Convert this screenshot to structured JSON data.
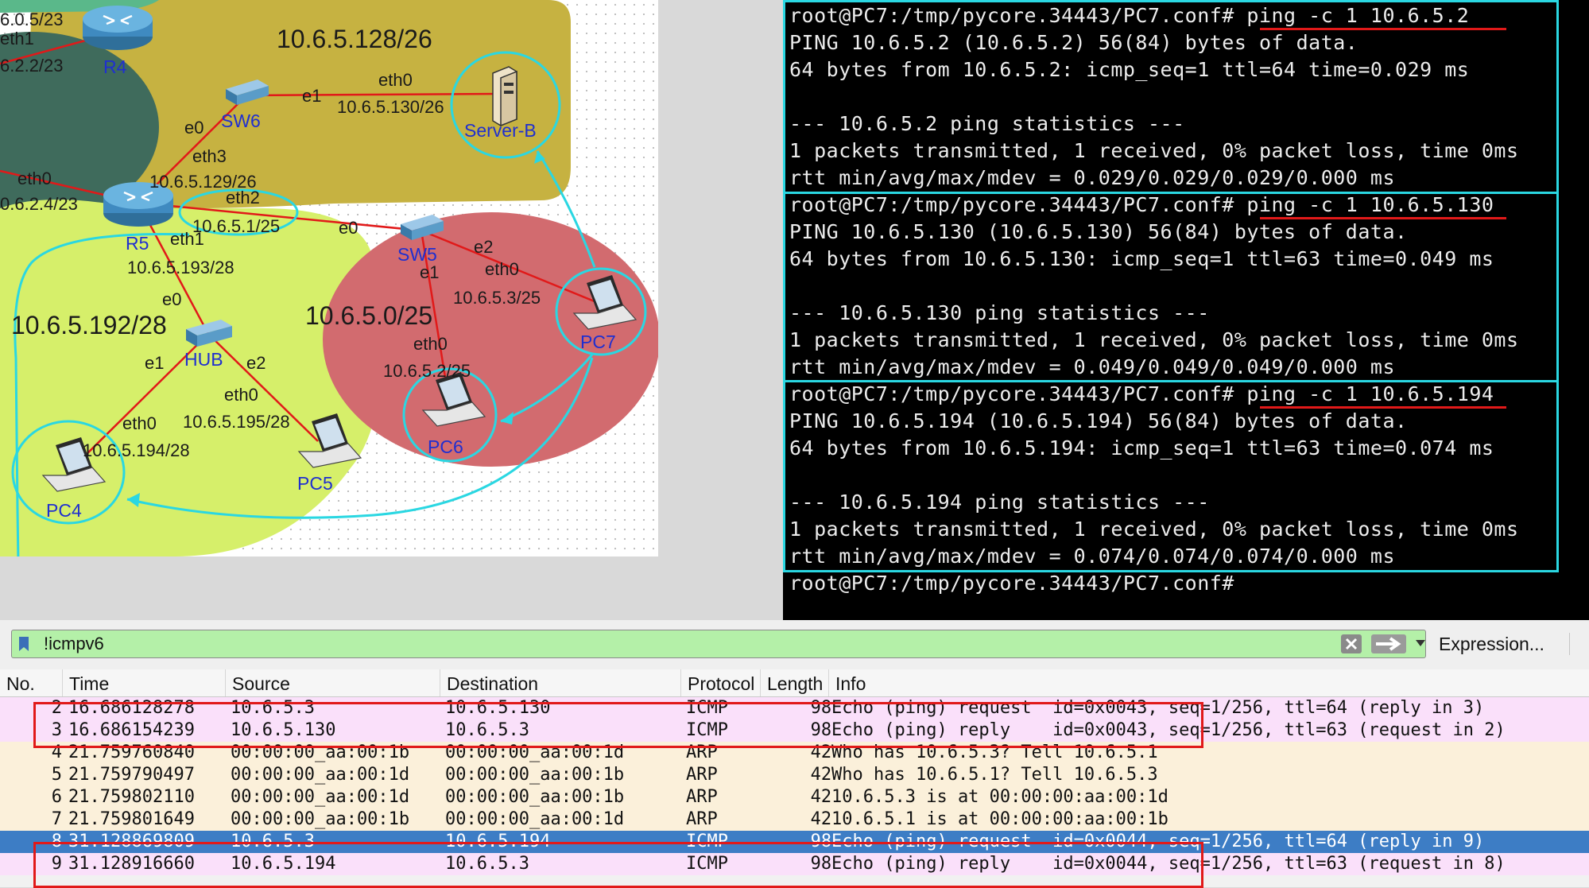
{
  "diagram": {
    "subnets": [
      "10.6.5.128/26",
      "10.6.5.192/28",
      "10.6.5.0/25"
    ],
    "interface_labels": {
      "top_addr": "6.0.5/23",
      "eth1_top": "eth1",
      "left_addr": "6.2.2/23",
      "eth0_left": "eth0",
      "left_addr2": "0.6.2.4/23",
      "r5_eth3": "eth3",
      "r5_eth3_addr": "10.6.5.129/26",
      "r5_eth2": "eth2",
      "r5_eth2_addr": "10.6.5.1/25",
      "r5_eth1": "eth1",
      "r5_eth1_addr": "10.6.5.193/28",
      "sw6_e0": "e0",
      "sw6_e1": "e1",
      "server_eth0": "eth0",
      "server_addr": "10.6.5.130/26",
      "sw5_e0": "e0",
      "sw5_e1": "e1",
      "sw5_e2": "e2",
      "pc7_eth0": "eth0",
      "pc7_addr": "10.6.5.3/25",
      "pc6_eth0": "eth0",
      "pc6_addr": "10.6.5.2/25",
      "hub_e0": "e0",
      "hub_e1": "e1",
      "hub_e2": "e2",
      "pc4_eth0": "eth0",
      "pc4_addr": "10.6.5.194/28",
      "pc5_eth0": "eth0",
      "pc5_addr": "10.6.5.195/28"
    },
    "nodes": {
      "r4": "R4",
      "r5": "R5",
      "sw6": "SW6",
      "sw5": "SW5",
      "hub": "HUB",
      "server_b": "Server-B",
      "pc4": "PC4",
      "pc5": "PC5",
      "pc6": "PC6",
      "pc7": "PC7"
    },
    "colors": {
      "zone_olive": "#c6b241",
      "zone_dark": "#3f6b5c",
      "zone_lime": "#d6ef6a",
      "zone_red": "#d26b6f",
      "annotation": "#2ad7e2",
      "link": "#e11919"
    }
  },
  "terminal": {
    "lines": [
      "root@PC7:/tmp/pycore.34443/PC7.conf# ping -c 1 10.6.5.2",
      "PING 10.6.5.2 (10.6.5.2) 56(84) bytes of data.",
      "64 bytes from 10.6.5.2: icmp_seq=1 ttl=64 time=0.029 ms",
      "",
      "--- 10.6.5.2 ping statistics ---",
      "1 packets transmitted, 1 received, 0% packet loss, time 0ms",
      "rtt min/avg/max/mdev = 0.029/0.029/0.029/0.000 ms",
      "root@PC7:/tmp/pycore.34443/PC7.conf# ping -c 1 10.6.5.130",
      "PING 10.6.5.130 (10.6.5.130) 56(84) bytes of data.",
      "64 bytes from 10.6.5.130: icmp_seq=1 ttl=63 time=0.049 ms",
      "",
      "--- 10.6.5.130 ping statistics ---",
      "1 packets transmitted, 1 received, 0% packet loss, time 0ms",
      "rtt min/avg/max/mdev = 0.049/0.049/0.049/0.000 ms",
      "root@PC7:/tmp/pycore.34443/PC7.conf# ping -c 1 10.6.5.194",
      "PING 10.6.5.194 (10.6.5.194) 56(84) bytes of data.",
      "64 bytes from 10.6.5.194: icmp_seq=1 ttl=63 time=0.074 ms",
      "",
      "--- 10.6.5.194 ping statistics ---",
      "1 packets transmitted, 1 received, 0% packet loss, time 0ms",
      "rtt min/avg/max/mdev = 0.074/0.074/0.074/0.000 ms",
      "root@PC7:/tmp/pycore.34443/PC7.conf#"
    ]
  },
  "wireshark": {
    "filter": {
      "value": "!icmpv6",
      "expression_label": "Expression..."
    },
    "columns": [
      "No.",
      "Time",
      "Source",
      "Destination",
      "Protocol",
      "Length",
      "Info"
    ],
    "packets": [
      {
        "no": "2",
        "time": "16.686128278",
        "source": "10.6.5.3",
        "destination": "10.6.5.130",
        "protocol": "ICMP",
        "length": "98",
        "info": "Echo (ping) request  id=0x0043, seq=1/256, ttl=64 (reply in 3)",
        "kind": "icmp"
      },
      {
        "no": "3",
        "time": "16.686154239",
        "source": "10.6.5.130",
        "destination": "10.6.5.3",
        "protocol": "ICMP",
        "length": "98",
        "info": "Echo (ping) reply    id=0x0043, seq=1/256, ttl=63 (request in 2)",
        "kind": "icmp"
      },
      {
        "no": "4",
        "time": "21.759760840",
        "source": "00:00:00_aa:00:1b",
        "destination": "00:00:00_aa:00:1d",
        "protocol": "ARP",
        "length": "42",
        "info": "Who has 10.6.5.3? Tell 10.6.5.1",
        "kind": "arp"
      },
      {
        "no": "5",
        "time": "21.759790497",
        "source": "00:00:00_aa:00:1d",
        "destination": "00:00:00_aa:00:1b",
        "protocol": "ARP",
        "length": "42",
        "info": "Who has 10.6.5.1? Tell 10.6.5.3",
        "kind": "arp"
      },
      {
        "no": "6",
        "time": "21.759802110",
        "source": "00:00:00_aa:00:1d",
        "destination": "00:00:00_aa:00:1b",
        "protocol": "ARP",
        "length": "42",
        "info": "10.6.5.3 is at 00:00:00:aa:00:1d",
        "kind": "arp"
      },
      {
        "no": "7",
        "time": "21.759801649",
        "source": "00:00:00_aa:00:1b",
        "destination": "00:00:00_aa:00:1d",
        "protocol": "ARP",
        "length": "42",
        "info": "10.6.5.1 is at 00:00:00:aa:00:1b",
        "kind": "arp"
      },
      {
        "no": "8",
        "time": "31.128869809",
        "source": "10.6.5.3",
        "destination": "10.6.5.194",
        "protocol": "ICMP",
        "length": "98",
        "info": "Echo (ping) request  id=0x0044, seq=1/256, ttl=64 (reply in 9)",
        "kind": "selected"
      },
      {
        "no": "9",
        "time": "31.128916660",
        "source": "10.6.5.194",
        "destination": "10.6.5.3",
        "protocol": "ICMP",
        "length": "98",
        "info": "Echo (ping) reply    id=0x0044, seq=1/256, ttl=63 (request in 8)",
        "kind": "icmp"
      }
    ]
  }
}
